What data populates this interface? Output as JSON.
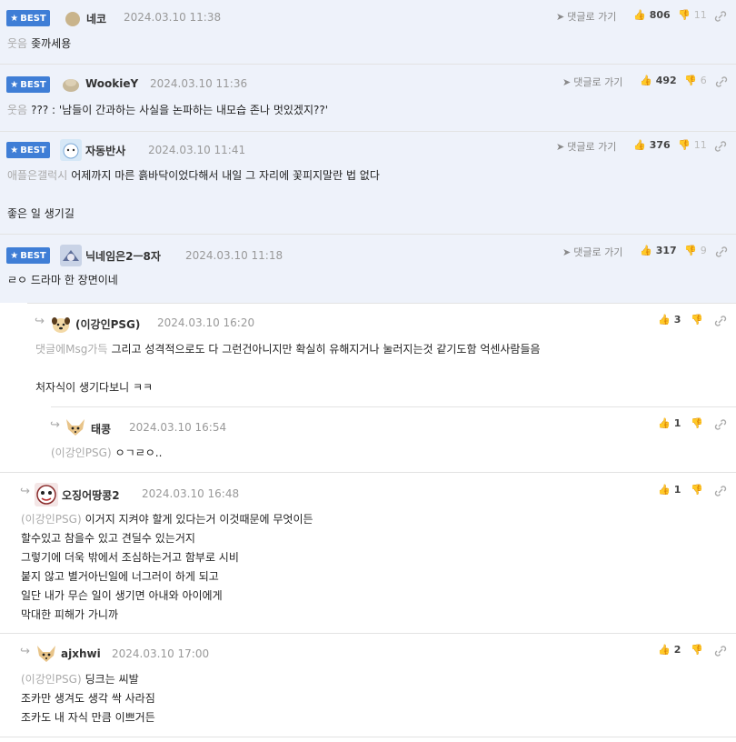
{
  "colors": {
    "best_bg": "#eef2fa",
    "badge": "#3f7ed6",
    "muted": "#999999"
  },
  "icons": {
    "badge_star": "star-icon",
    "reply": "paper-plane-icon",
    "up": "thumbs-up-icon",
    "down": "thumbs-down-icon",
    "link": "link-icon",
    "nested": "reply-arrow-icon"
  },
  "reply_label": "댓글로 가기",
  "best_label": "BEST",
  "comments": [
    {
      "nick": "네코",
      "date": "2024.03.10 11:38",
      "up": "806",
      "down": "11",
      "tag": "웃음",
      "lines": [
        "좆까세용"
      ]
    },
    {
      "nick": "WookieY",
      "date": "2024.03.10 11:36",
      "up": "492",
      "down": "6",
      "tag": "웃음",
      "lines": [
        "??? : '남들이 간과하는 사실을 논파하는 내모습 존나 멋있겠지??'"
      ]
    },
    {
      "nick": "자동반사",
      "date": "2024.03.10 11:41",
      "up": "376",
      "down": "11",
      "tag": "애플은갤럭시",
      "lines": [
        "어제까지 마른 흙바닥이었다해서 내일 그 자리에 꽃피지말란 법 없다",
        "",
        "좋은 일 생기길"
      ]
    },
    {
      "nick": "닉네임은2ㅡ8자",
      "date": "2024.03.10 11:18",
      "up": "317",
      "down": "9",
      "tag": "",
      "lines": [
        "ㄹㅇ 드라마 한 장면이네"
      ]
    },
    {
      "nick": "(이강인PSG)",
      "date": "2024.03.10 16:20",
      "up": "3",
      "tag": "댓글에Msg가득",
      "lines": [
        "그리고 성격적으로도 다 그런건아니지만 확실히 유해지거나 눌러지는것 같기도함 억센사람들음",
        "",
        "처자식이 생기다보니 ㅋㅋ"
      ]
    },
    {
      "nick": "태콩",
      "date": "2024.03.10 16:54",
      "up": "1",
      "tag": "(이강인PSG)",
      "lines": [
        "ㅇㄱㄹㅇ.."
      ]
    },
    {
      "nick": "오징어땅콩2",
      "date": "2024.03.10 16:48",
      "up": "1",
      "tag": "(이강인PSG)",
      "lines": [
        "이거지 지켜야 할게 있다는거 이것때문에 무엇이든",
        "할수있고 참을수 있고 견딜수 있는거지",
        "그렇기에 더욱 밖에서 조심하는거고 함부로 시비",
        "붙지 않고 별거아닌일에 너그러이 하게 되고",
        "일단 내가 무슨 일이 생기면 아내와 아이에게",
        "막대한 피해가 가니까"
      ]
    },
    {
      "nick": "ajxhwi",
      "date": "2024.03.10 17:00",
      "up": "2",
      "tag": "(이강인PSG)",
      "lines": [
        "딩크는 씨발",
        "조카만 생겨도 생각 싹 사라짐",
        "조카도 내 자식 만큼 이쁘거든"
      ]
    }
  ]
}
